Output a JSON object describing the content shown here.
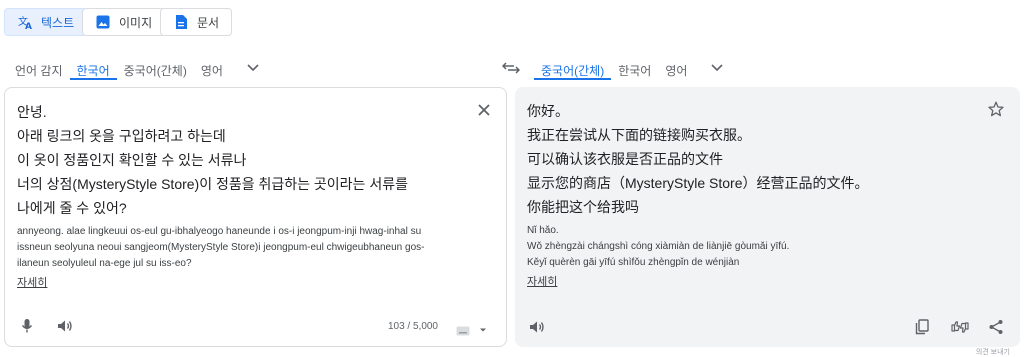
{
  "mode_tabs": [
    {
      "label": "텍스트",
      "icon": "translate-icon",
      "active": true
    },
    {
      "label": "이미지",
      "icon": "image-icon",
      "active": false
    },
    {
      "label": "문서",
      "icon": "document-icon",
      "active": false
    }
  ],
  "source_langs": [
    "언어 감지",
    "한국어",
    "중국어(간체)",
    "영어"
  ],
  "source_active_index": 1,
  "target_langs": [
    "중국어(간체)",
    "한국어",
    "영어"
  ],
  "target_active_index": 0,
  "source": {
    "lines": [
      "안녕.",
      "아래 링크의 옷을 구입하려고 하는데",
      "이 옷이 정품인지 확인할 수 있는 서류나",
      "너의 상점(MysteryStyle Store)이 정품을 취급하는 곳이라는 서류를",
      "나에게 줄 수 있어?"
    ],
    "romanization": [
      "annyeong. alae lingkeuui os-eul gu-ibhalyeogo haneunde i os-i jeongpum-inji hwag-inhal su",
      "issneun seolyuna neoui sangjeom(MysteryStyle Store)i jeongpum-eul chwigeubhaneun gos-",
      "ilaneun seolyuleul na-ege jul su iss-eo?"
    ],
    "detail_label": "자세히",
    "char_count": "103 / 5,000"
  },
  "target": {
    "lines": [
      "你好。",
      "我正在尝试从下面的链接购买衣服。",
      "可以确认该衣服是否正品的文件",
      "显示您的商店（MysteryStyle Store）经营正品的文件。",
      "你能把这个给我吗"
    ],
    "romanization": [
      "Nǐ hǎo.",
      "Wǒ zhèngzài chángshì cóng xiàmiàn de liànjiē gòumǎi yīfú.",
      "Kěyǐ quèrèn gāi yīfú shìfǒu zhèngpǐn de wénjiàn"
    ],
    "detail_label": "자세히"
  },
  "footnote": "의견 보내기",
  "colors": {
    "accent": "#1a73e8",
    "border": "#dadce0",
    "panel_bg": "#f1f3f4",
    "icon": "#5f6368"
  }
}
